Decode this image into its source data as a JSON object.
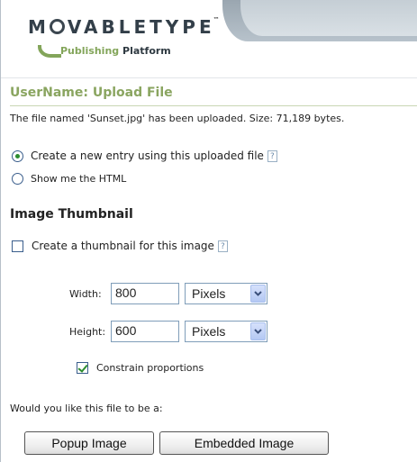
{
  "header": {
    "logo_word_pre": "M",
    "logo_word_post": "VABLETYPE",
    "logo_tm": "™",
    "logo_sub_publishing": "Publishing",
    "logo_sub_platform": "Platform"
  },
  "page": {
    "title": "UserName: Upload File",
    "status": "The file named 'Sunset.jpg' has been uploaded. Size: 71,189 bytes."
  },
  "options": {
    "create_entry_label": "Create a new entry using this uploaded file",
    "create_entry_checked": true,
    "show_html_label": "Show me the HTML",
    "show_html_checked": false,
    "help_glyph": "?"
  },
  "thumbnail": {
    "heading": "Image Thumbnail",
    "create_label": "Create a thumbnail for this image",
    "create_checked": false,
    "width_label": "Width:",
    "width_value": "800",
    "width_unit": "Pixels",
    "height_label": "Height:",
    "height_value": "600",
    "height_unit": "Pixels",
    "constrain_label": "Constrain proportions",
    "constrain_checked": true
  },
  "file_as": {
    "question": "Would you like this file to be a:",
    "popup_label": "Popup Image",
    "embedded_label": "Embedded Image"
  },
  "colors": {
    "title_green": "#8aa560",
    "radio_dot": "#2d8d2f",
    "control_border": "#7f9db9"
  }
}
